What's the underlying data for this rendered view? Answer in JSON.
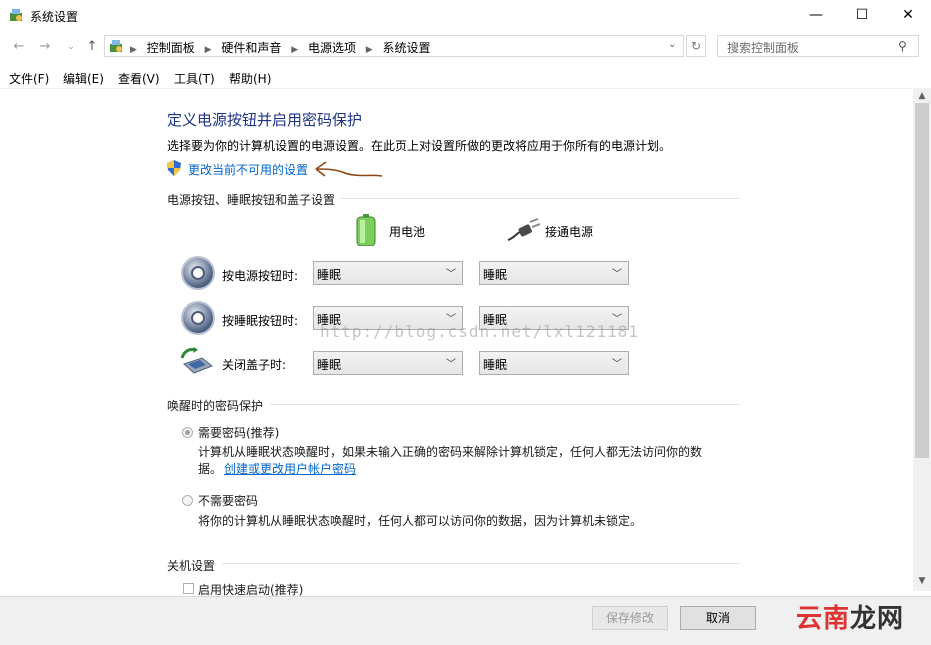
{
  "window": {
    "title": "系统设置",
    "minimize_glyph": "—",
    "maximize_glyph": "☐",
    "close_glyph": "✕"
  },
  "address": {
    "crumbs": [
      "控制面板",
      "硬件和声音",
      "电源选项",
      "系统设置"
    ],
    "search_placeholder": "搜索控制面板"
  },
  "menu": [
    "文件(F)",
    "编辑(E)",
    "查看(V)",
    "工具(T)",
    "帮助(H)"
  ],
  "page": {
    "title": "定义电源按钮并启用密码保护",
    "description": "选择要为你的计算机设置的电源设置。在此页上对设置所做的更改将应用于你所有的电源计划。",
    "change_link": "更改当前不可用的设置"
  },
  "power_section": {
    "title": "电源按钮、睡眠按钮和盖子设置",
    "col_battery": "用电池",
    "col_ac": "接通电源",
    "rows": [
      {
        "label": "按电源按钮时:",
        "battery": "睡眠",
        "ac": "睡眠"
      },
      {
        "label": "按睡眠按钮时:",
        "battery": "睡眠",
        "ac": "睡眠"
      },
      {
        "label": "关闭盖子时:",
        "battery": "睡眠",
        "ac": "睡眠"
      }
    ]
  },
  "password_section": {
    "title": "唤醒时的密码保护",
    "require_label": "需要密码(推荐)",
    "require_desc_1": "计算机从睡眠状态唤醒时，如果未输入正确的密码来解除计算机锁定，任何人都无法访问你的数",
    "require_desc_2": "据。",
    "require_link": "创建或更改用户帐户密码",
    "norequire_label": "不需要密码",
    "norequire_desc": "将你的计算机从睡眠状态唤醒时，任何人都可以访问你的数据，因为计算机未锁定。"
  },
  "shutdown_section": {
    "title": "关机设置",
    "first_item_partial": "启用快速启动(推荐)"
  },
  "footer": {
    "save_label": "保存修改",
    "cancel_label": "取消"
  },
  "watermark": {
    "url": "http://blog.csdn.net/lxl121181",
    "logo_red": "云南",
    "logo_dark": "龙网"
  },
  "colors": {
    "title_blue": "#1e3287",
    "link_blue": "#0066cc",
    "annotation_arrow": "#8b4513"
  }
}
